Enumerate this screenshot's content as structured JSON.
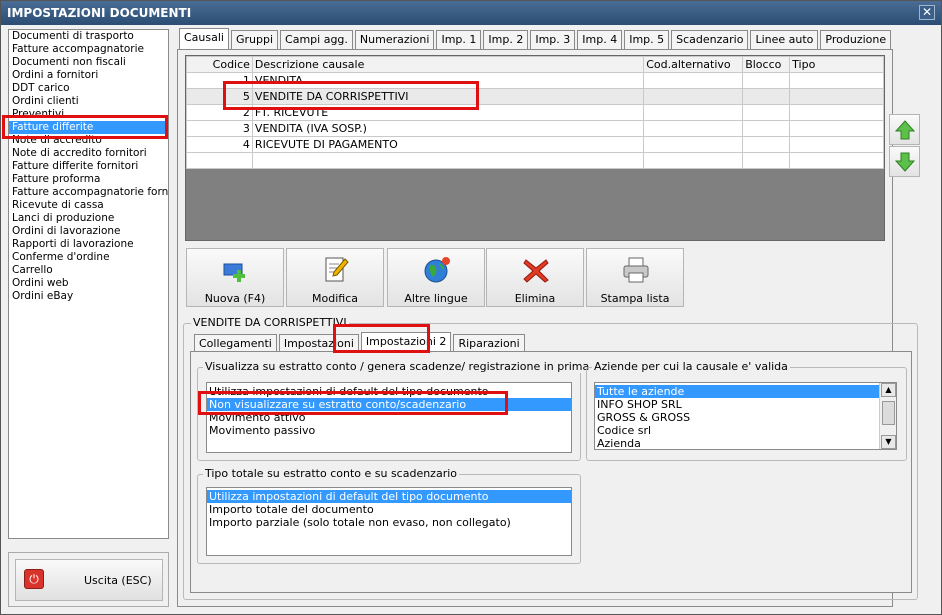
{
  "window": {
    "title": "IMPOSTAZIONI DOCUMENTI",
    "close": "✕"
  },
  "doc_list": [
    "Documenti di trasporto",
    "Fatture accompagnatorie",
    "Documenti non fiscali",
    "Ordini a fornitori",
    "DDT carico",
    "Ordini clienti",
    "Preventivi",
    "Fatture differite",
    "Note di accredito",
    "Note di accredito fornitori",
    "Fatture differite fornitori",
    "Fatture proforma",
    "Fatture accompagnatorie fornito",
    "Ricevute di cassa",
    "Lanci di produzione",
    "Ordini di lavorazione",
    "Rapporti di lavorazione",
    "Conferme d'ordine",
    "Carrello",
    "Ordini web",
    "Ordini eBay"
  ],
  "doc_list_selected": "Fatture differite",
  "exit_button": "Uscita (ESC)",
  "main_tabs": [
    "Causali",
    "Gruppi",
    "Campi agg.",
    "Numerazioni",
    "Imp. 1",
    "Imp. 2",
    "Imp. 3",
    "Imp. 4",
    "Imp. 5",
    "Scadenzario",
    "Linee auto",
    "Produzione"
  ],
  "main_tab_active": "Causali",
  "grid": {
    "columns": [
      "Codice",
      "Descrizione causale",
      "Cod.alternativo",
      "Blocco",
      "Tipo"
    ],
    "rows": [
      [
        "1",
        "VENDITA",
        "",
        "",
        ""
      ],
      [
        "5",
        "VENDITE DA CORRISPETTIVI",
        "",
        "",
        ""
      ],
      [
        "2",
        "FT. RICEVUTE",
        "",
        "",
        ""
      ],
      [
        "3",
        "VENDITA (IVA SOSP.)",
        "",
        "",
        ""
      ],
      [
        "4",
        "RICEVUTE DI PAGAMENTO",
        "",
        "",
        ""
      ],
      [
        "",
        "",
        "",
        "",
        ""
      ]
    ]
  },
  "toolbar": {
    "new": "Nuova (F4)",
    "edit": "Modifica",
    "languages": "Altre lingue",
    "delete": "Elimina",
    "print": "Stampa lista"
  },
  "details": {
    "title": "VENDITE DA CORRISPETTIVI",
    "tabs": [
      "Collegamenti",
      "Impostazioni",
      "Impostazioni 2",
      "Riparazioni"
    ],
    "active_tab": "Impostazioni 2",
    "visualizza": {
      "title": "Visualizza su estratto conto / genera scadenze/ registrazione  in prima nota",
      "options": [
        "Utilizza impostazioni di default del tipo documento",
        "Non visualizzare su estratto conto/scadenzario",
        "Movimento attivo",
        "Movimento passivo"
      ],
      "selected": "Non visualizzare su estratto conto/scadenzario"
    },
    "aziende": {
      "title": "Aziende per cui la causale e' valida",
      "options": [
        "Tutte le aziende",
        "INFO SHOP SRL",
        "GROSS & GROSS",
        "Codice srl",
        "Azienda"
      ],
      "selected": "Tutte le aziende"
    },
    "tipo_totale": {
      "title": "Tipo totale su estratto conto e su scadenzario",
      "options": [
        "Utilizza impostazioni di default del tipo documento",
        "Importo totale del documento",
        "Importo parziale (solo totale non evaso, non collegato)"
      ],
      "selected": "Utilizza impostazioni di default del tipo documento"
    }
  },
  "colors": {
    "selection": "#3399ff",
    "highlight_box": "#e01010",
    "titlebar": "#2b4d74"
  },
  "icons": {
    "up": "green-up-arrow-icon",
    "down": "green-down-arrow-icon",
    "new": "add-document-icon",
    "edit": "edit-note-icon",
    "languages": "globe-icon",
    "delete": "red-x-icon",
    "print": "printer-icon",
    "exit": "power-icon"
  }
}
